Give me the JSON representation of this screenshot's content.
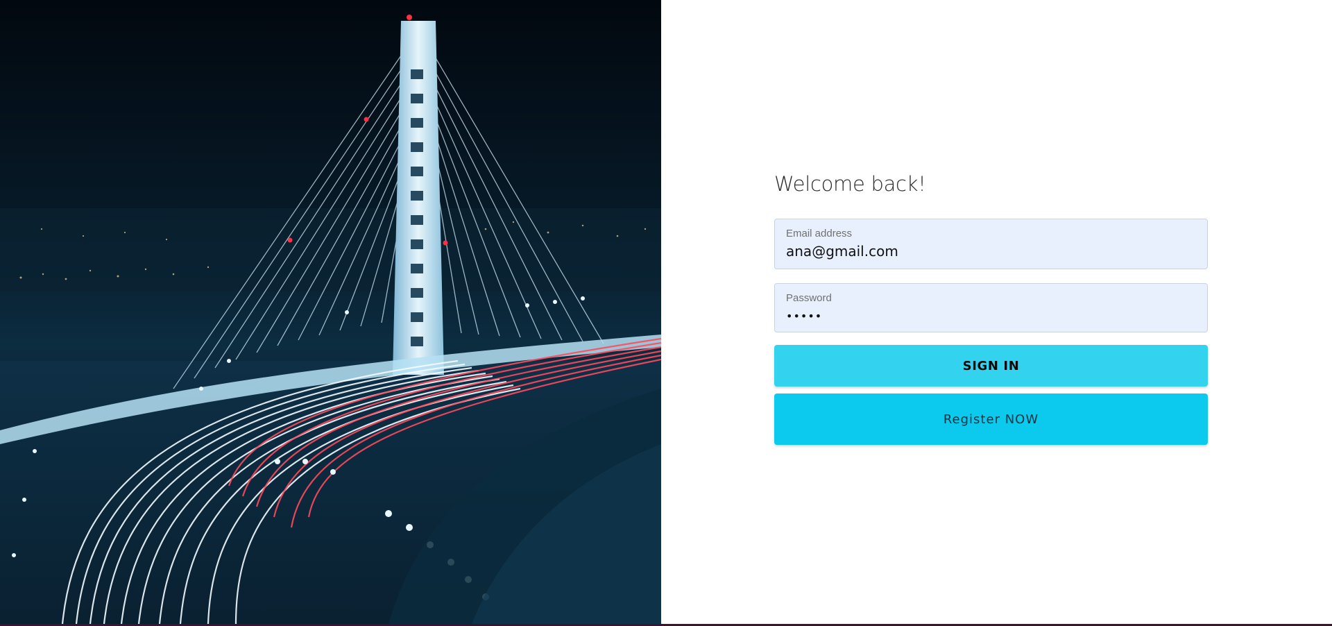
{
  "hero": {
    "image": "night-bridge-light-trails"
  },
  "form": {
    "title": "Welcome back!",
    "email": {
      "label": "Email address",
      "value": "ana@gmail.com"
    },
    "password": {
      "label": "Password",
      "value": "•••••"
    },
    "signin_label": "SIGN IN",
    "register_label": "Register NOW"
  },
  "colors": {
    "signin_button": "#33d3f0",
    "register_button": "#0cc9ee",
    "field_background": "#e8f0fe"
  }
}
